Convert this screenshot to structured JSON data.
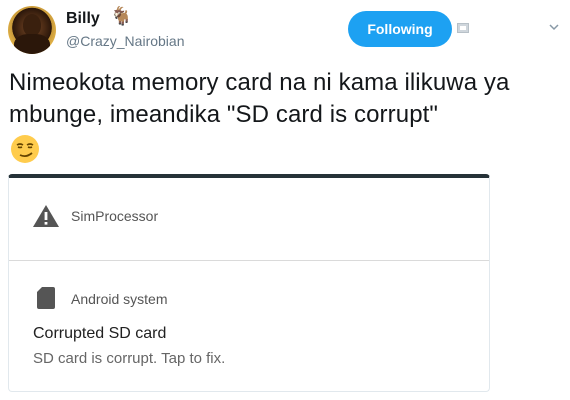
{
  "tweet": {
    "author": {
      "name": "Billy",
      "name_emoji": "🐐",
      "handle": "@Crazy_Nairobian"
    },
    "follow_button_label": "Following",
    "text": "Nimeokota memory card na ni kama ilikuwa ya mbunge, imeandika \"SD card is corrupt\"",
    "trailing_emoji": "smirking-face"
  },
  "screenshot": {
    "notification1": {
      "icon": "warning-icon",
      "app_name": "SimProcessor"
    },
    "notification2": {
      "icon": "sd-card-icon",
      "app_name": "Android system",
      "title": "Corrupted SD card",
      "text": "SD card is corrupt. Tap to fix."
    }
  },
  "colors": {
    "follow_button": "#1da1f2",
    "text": "#14171a",
    "secondary_text": "#657786"
  }
}
